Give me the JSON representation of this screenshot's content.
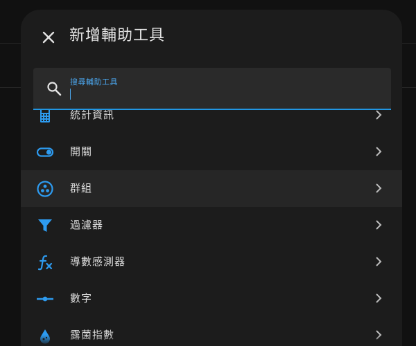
{
  "dialog": {
    "title": "新增輔助工具",
    "close_icon": "close-icon"
  },
  "search": {
    "label": "搜尋輔助工具",
    "value": "",
    "icon": "search-icon"
  },
  "items": [
    {
      "label": "統計資訊",
      "icon": "calculator-icon"
    },
    {
      "label": "開關",
      "icon": "toggle-switch-icon"
    },
    {
      "label": "群組",
      "icon": "group-circle-icon"
    },
    {
      "label": "過濾器",
      "icon": "filter-icon"
    },
    {
      "label": "導數感測器",
      "icon": "function-fx-icon"
    },
    {
      "label": "數字",
      "icon": "slider-icon"
    },
    {
      "label": "露菌指數",
      "icon": "mold-icon"
    }
  ],
  "colors": {
    "accent": "#2196e3",
    "icon": "#2d9bf0",
    "background": "#1c1c1c",
    "hover_row": "#262626",
    "text": "#dcdcdc"
  }
}
